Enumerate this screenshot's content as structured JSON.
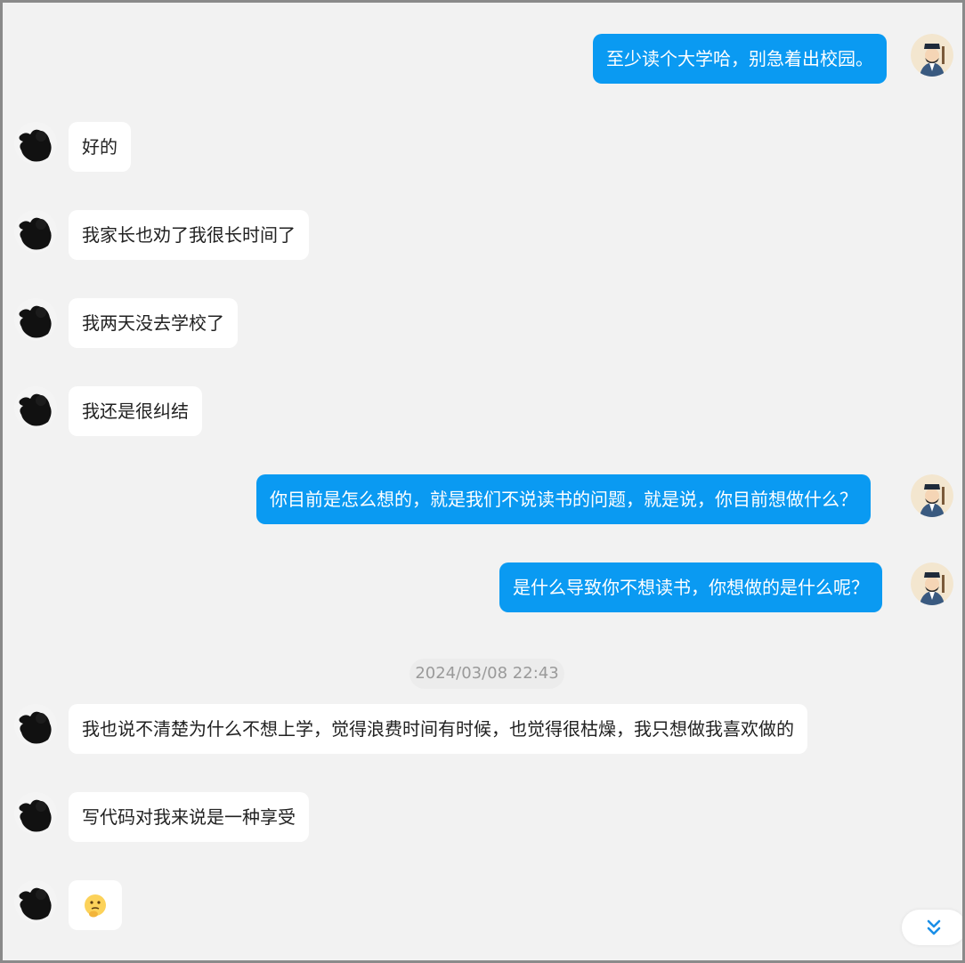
{
  "messages": [
    {
      "side": "out",
      "text": "至少读个大学哈，别急着出校园。"
    },
    {
      "side": "in",
      "text": "好的"
    },
    {
      "side": "in",
      "text": "我家长也劝了我很长时间了"
    },
    {
      "side": "in",
      "text": "我两天没去学校了"
    },
    {
      "side": "in",
      "text": "我还是很纠结"
    },
    {
      "side": "out",
      "text": "你目前是怎么想的，就是我们不说读书的问题，就是说，你目前想做什么？"
    },
    {
      "side": "out",
      "text": "是什么导致你不想读书，你想做的是什么呢？"
    },
    {
      "side": "in",
      "text": "我也说不清楚为什么不想上学，觉得浪费时间有时候，也觉得很枯燥，我只想做我喜欢做的"
    },
    {
      "side": "in",
      "text": "写代码对我来说是一种享受"
    },
    {
      "side": "in",
      "text": "",
      "emoji": "thinking-face-emoji"
    }
  ],
  "timestamp": "2024/03/08 22:43",
  "scroll_button": {
    "icon": "double-chevron-down-icon"
  },
  "colors": {
    "outgoing_bubble": "#0a9af2",
    "incoming_bubble": "#ffffff",
    "background": "#f2f2f2",
    "timestamp_text": "#9a9a9a"
  }
}
